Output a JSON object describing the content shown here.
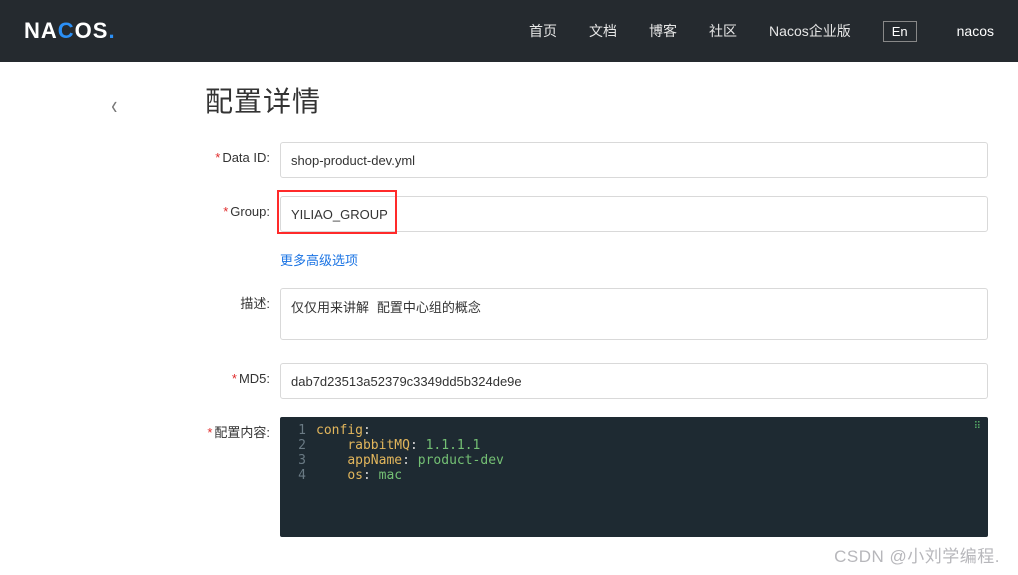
{
  "header": {
    "logo_text": "NACOS",
    "nav": {
      "home": "首页",
      "docs": "文档",
      "blog": "博客",
      "community": "社区",
      "enterprise": "Nacos企业版"
    },
    "lang": "En",
    "username": "nacos"
  },
  "page": {
    "title": "配置详情",
    "back_glyph": "‹"
  },
  "form": {
    "data_id": {
      "label": "Data ID:",
      "value": "shop-product-dev.yml",
      "required": true
    },
    "group": {
      "label": "Group:",
      "value": "YILIAO_GROUP",
      "required": true
    },
    "advanced_link": "更多高级选项",
    "desc": {
      "label": "描述:",
      "value": "仅仅用来讲解 配置中心组的概念",
      "required": false
    },
    "md5": {
      "label": "MD5:",
      "value": "dab7d23513a52379c3349dd5b324de9e",
      "required": true
    },
    "content": {
      "label": "配置内容:",
      "required": true,
      "lines": [
        {
          "n": "1",
          "key": "config",
          "val": ""
        },
        {
          "n": "2",
          "key": "rabbitMQ",
          "val": "1.1.1.1",
          "indent": true
        },
        {
          "n": "3",
          "key": "appName",
          "val": "product-dev",
          "indent": true
        },
        {
          "n": "4",
          "key": "os",
          "val": "mac",
          "indent": true
        }
      ]
    }
  },
  "watermark": "CSDN @小刘学编程."
}
